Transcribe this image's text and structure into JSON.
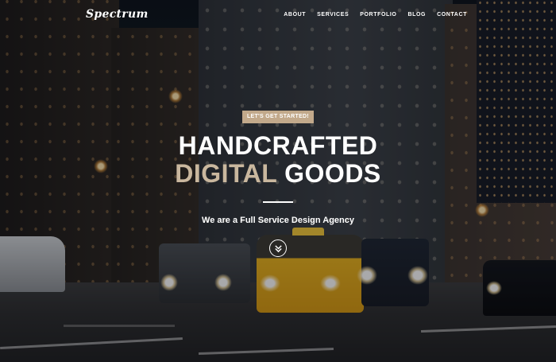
{
  "brand": {
    "logo_text": "Spectrum"
  },
  "nav": {
    "items": [
      {
        "label": "ABOUT"
      },
      {
        "label": "SERVICES"
      },
      {
        "label": "PORTFOLIO"
      },
      {
        "label": "BLOG"
      },
      {
        "label": "CONTACT"
      }
    ]
  },
  "hero": {
    "cta_label": "LET'S GET STARTED!",
    "title_line1": "HANDCRAFTED",
    "title_line2_accent": "DIGITAL",
    "title_line2_rest": "GOODS",
    "subtitle": "We are a Full Service Design Agency",
    "scroll_icon": "chevron-double-down-icon"
  },
  "colors": {
    "accent": "#c9b79e",
    "badge": "#c2a98b",
    "text": "#ffffff"
  }
}
